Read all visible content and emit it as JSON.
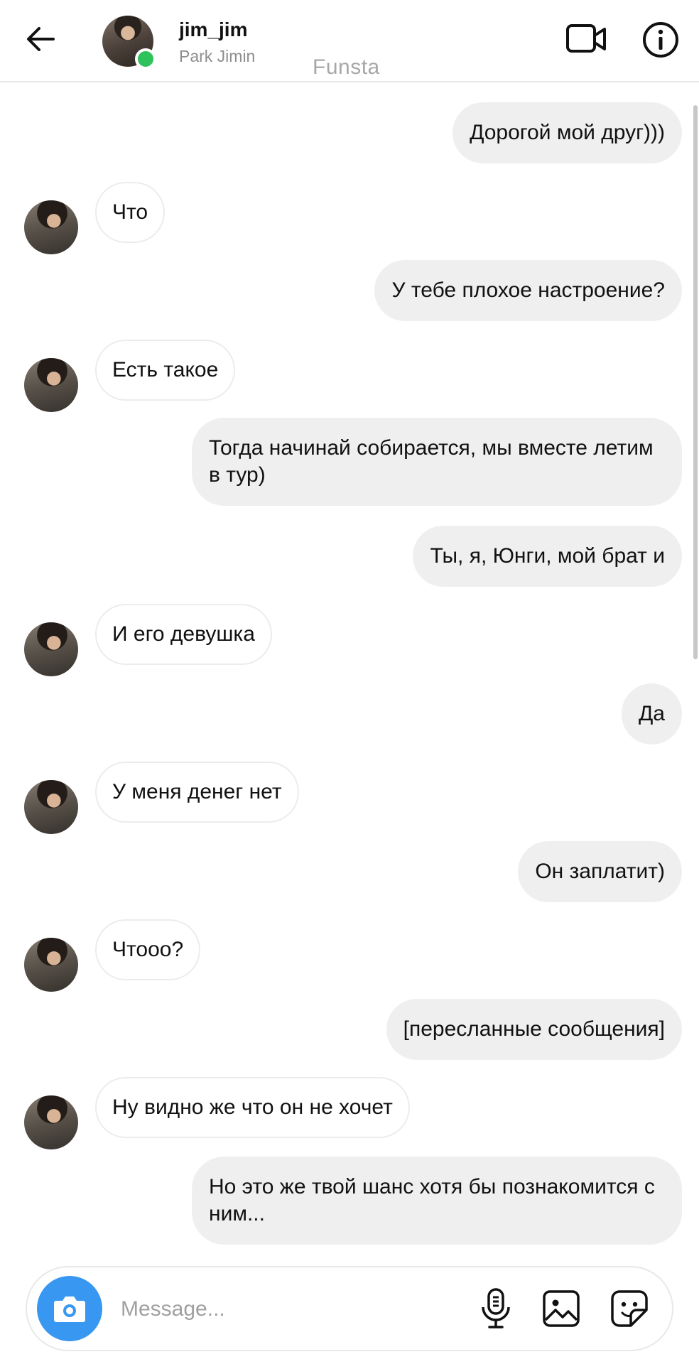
{
  "header": {
    "username": "jim_jim",
    "full_name": "Park Jimin",
    "watermark": "Funsta",
    "icons": [
      "back-arrow-icon",
      "video-call-icon",
      "info-icon"
    ],
    "online": true
  },
  "messages": [
    {
      "side": "out",
      "text": "Дорогой мой друг)))"
    },
    {
      "side": "in",
      "text": "Что"
    },
    {
      "side": "out",
      "text": "У тебе плохое настроение?"
    },
    {
      "side": "in",
      "text": "Есть такое"
    },
    {
      "side": "out",
      "text": "Тогда начинай собирается, мы вместе летим в тур)"
    },
    {
      "side": "out",
      "text": "Ты, я, Юнги, мой брат и"
    },
    {
      "side": "in",
      "text": "И его девушка"
    },
    {
      "side": "out",
      "text": "Да"
    },
    {
      "side": "in",
      "text": "У меня денег нет"
    },
    {
      "side": "out",
      "text": "Он заплатит)"
    },
    {
      "side": "in",
      "text": "Чтооо?"
    },
    {
      "side": "out",
      "text": "[пересланные сообщения]"
    },
    {
      "side": "in",
      "text": "Ну видно же что он не хочет"
    },
    {
      "side": "out",
      "text": "Но это же твой шанс хотя бы познакомится с ним..."
    }
  ],
  "composer": {
    "placeholder": "Message...",
    "value": "",
    "icons": [
      "camera-icon",
      "microphone-icon",
      "gallery-icon",
      "sticker-icon"
    ],
    "accent_color": "#3897f0"
  },
  "colors": {
    "outgoing_bubble": "#efefef",
    "incoming_border": "#ececec",
    "online_dot": "#2ec25c"
  }
}
